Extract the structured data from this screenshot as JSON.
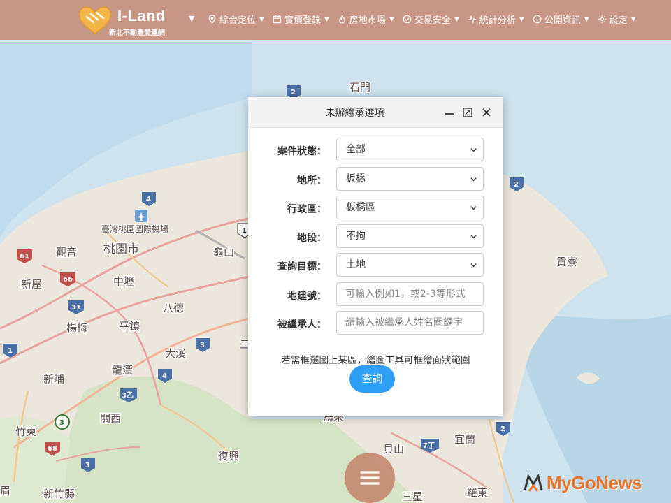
{
  "app": {
    "logo_title": "I-Land",
    "logo_subtitle": "新北不動產愛連網"
  },
  "nav": {
    "items": [
      {
        "label": "綜合定位",
        "icon": "map-pin-icon"
      },
      {
        "label": "實價登錄",
        "icon": "calendar-icon"
      },
      {
        "label": "房地市場",
        "icon": "fire-icon"
      },
      {
        "label": "交易安全",
        "icon": "check-circle-icon"
      },
      {
        "label": "統計分析",
        "icon": "pulse-icon"
      },
      {
        "label": "公開資訊",
        "icon": "info-icon"
      },
      {
        "label": "設定",
        "icon": "gear-icon"
      }
    ]
  },
  "dialog": {
    "title": "未辦繼承選項",
    "fields": [
      {
        "label": "案件狀態：",
        "type": "select",
        "value": "全部"
      },
      {
        "label": "地所：",
        "type": "select",
        "value": "板橋"
      },
      {
        "label": "行政區：",
        "type": "select",
        "value": "板橋區"
      },
      {
        "label": "地段：",
        "type": "select",
        "value": "不拘"
      },
      {
        "label": "查詢目標：",
        "type": "select",
        "value": "土地"
      },
      {
        "label": "地建號：",
        "type": "input",
        "value": "",
        "placeholder": "可輸入例如1，或2-3等形式"
      },
      {
        "label": "被繼承人：",
        "type": "input",
        "value": "",
        "placeholder": "請輸入被繼承人姓名關鍵字"
      }
    ],
    "hint": "若需框選圖上某區，繪圖工具可框繪面狀範圍",
    "query_label": "查詢"
  },
  "map": {
    "labels": [
      "石門",
      "臺灣桃園國際機場",
      "觀音",
      "桃園市",
      "龜山",
      "新屋",
      "中壢",
      "八德",
      "楊梅",
      "平鎮",
      "大溪",
      "龍潭",
      "新埔",
      "關西",
      "竹東",
      "新竹縣",
      "復興",
      "烏來",
      "貝山",
      "宜蘭",
      "羅東",
      "貢寮",
      "三星",
      "眉",
      "三"
    ],
    "route_shields": [
      "2",
      "4",
      "1",
      "61",
      "66",
      "31",
      "1",
      "3",
      "4",
      "3乙",
      "3",
      "68",
      "3",
      "2",
      "7丁",
      "2"
    ]
  },
  "watermark": {
    "text": "MyGoNews"
  },
  "colors": {
    "topbar": "#c4856e",
    "accent_button": "#2f9ef5",
    "watermark": "#e8732a",
    "sea": "#cfe3ee",
    "land": "#ece7dc"
  }
}
